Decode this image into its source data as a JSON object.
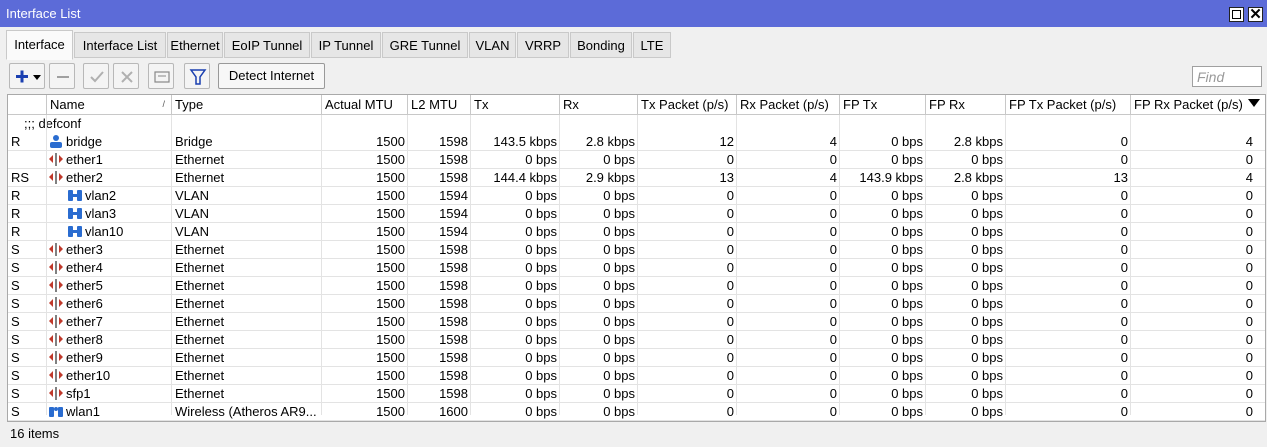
{
  "window": {
    "title": "Interface List"
  },
  "tabs": [
    {
      "label": "Interface"
    },
    {
      "label": "Interface List"
    },
    {
      "label": "Ethernet"
    },
    {
      "label": "EoIP Tunnel"
    },
    {
      "label": "IP Tunnel"
    },
    {
      "label": "GRE Tunnel"
    },
    {
      "label": "VLAN"
    },
    {
      "label": "VRRP"
    },
    {
      "label": "Bonding"
    },
    {
      "label": "LTE"
    }
  ],
  "toolbar": {
    "add_icon": "plus-icon",
    "remove_icon": "minus-icon",
    "enable_icon": "check-icon",
    "disable_icon": "x-icon",
    "comment_icon": "comment-icon",
    "filter_icon": "filter-icon",
    "detect_label": "Detect Internet",
    "find_placeholder": "Find"
  },
  "columns": [
    {
      "label": ""
    },
    {
      "label": "Name"
    },
    {
      "label": "Type"
    },
    {
      "label": "Actual MTU"
    },
    {
      "label": "L2 MTU"
    },
    {
      "label": "Tx"
    },
    {
      "label": "Rx"
    },
    {
      "label": "Tx Packet (p/s)"
    },
    {
      "label": "Rx Packet (p/s)"
    },
    {
      "label": "FP Tx"
    },
    {
      "label": "FP Rx"
    },
    {
      "label": "FP Tx Packet (p/s)"
    },
    {
      "label": "FP Rx Packet (p/s)"
    }
  ],
  "group": {
    "label": ";;; defconf"
  },
  "rows": [
    {
      "flag": "R",
      "name": "bridge",
      "icon": "bridge",
      "type": "Bridge",
      "mtu": "1500",
      "l2mtu": "1598",
      "tx": "143.5 kbps",
      "rx": "2.8 kbps",
      "txp": "12",
      "rxp": "4",
      "fptx": "0 bps",
      "fprx": "2.8 kbps",
      "fptxp": "0",
      "fprxp": "4"
    },
    {
      "flag": "",
      "name": "ether1",
      "icon": "ethernet",
      "type": "Ethernet",
      "mtu": "1500",
      "l2mtu": "1598",
      "tx": "0 bps",
      "rx": "0 bps",
      "txp": "0",
      "rxp": "0",
      "fptx": "0 bps",
      "fprx": "0 bps",
      "fptxp": "0",
      "fprxp": "0"
    },
    {
      "flag": "RS",
      "name": "ether2",
      "icon": "ethernet",
      "type": "Ethernet",
      "mtu": "1500",
      "l2mtu": "1598",
      "tx": "144.4 kbps",
      "rx": "2.9 kbps",
      "txp": "13",
      "rxp": "4",
      "fptx": "143.9 kbps",
      "fprx": "2.8 kbps",
      "fptxp": "13",
      "fprxp": "4"
    },
    {
      "flag": "R",
      "name": "vlan2",
      "icon": "vlan",
      "type": "VLAN",
      "mtu": "1500",
      "l2mtu": "1594",
      "tx": "0 bps",
      "rx": "0 bps",
      "txp": "0",
      "rxp": "0",
      "fptx": "0 bps",
      "fprx": "0 bps",
      "fptxp": "0",
      "fprxp": "0"
    },
    {
      "flag": "R",
      "name": "vlan3",
      "icon": "vlan",
      "type": "VLAN",
      "mtu": "1500",
      "l2mtu": "1594",
      "tx": "0 bps",
      "rx": "0 bps",
      "txp": "0",
      "rxp": "0",
      "fptx": "0 bps",
      "fprx": "0 bps",
      "fptxp": "0",
      "fprxp": "0"
    },
    {
      "flag": "R",
      "name": "vlan10",
      "icon": "vlan",
      "type": "VLAN",
      "mtu": "1500",
      "l2mtu": "1594",
      "tx": "0 bps",
      "rx": "0 bps",
      "txp": "0",
      "rxp": "0",
      "fptx": "0 bps",
      "fprx": "0 bps",
      "fptxp": "0",
      "fprxp": "0"
    },
    {
      "flag": "S",
      "name": "ether3",
      "icon": "ethernet",
      "type": "Ethernet",
      "mtu": "1500",
      "l2mtu": "1598",
      "tx": "0 bps",
      "rx": "0 bps",
      "txp": "0",
      "rxp": "0",
      "fptx": "0 bps",
      "fprx": "0 bps",
      "fptxp": "0",
      "fprxp": "0"
    },
    {
      "flag": "S",
      "name": "ether4",
      "icon": "ethernet",
      "type": "Ethernet",
      "mtu": "1500",
      "l2mtu": "1598",
      "tx": "0 bps",
      "rx": "0 bps",
      "txp": "0",
      "rxp": "0",
      "fptx": "0 bps",
      "fprx": "0 bps",
      "fptxp": "0",
      "fprxp": "0"
    },
    {
      "flag": "S",
      "name": "ether5",
      "icon": "ethernet",
      "type": "Ethernet",
      "mtu": "1500",
      "l2mtu": "1598",
      "tx": "0 bps",
      "rx": "0 bps",
      "txp": "0",
      "rxp": "0",
      "fptx": "0 bps",
      "fprx": "0 bps",
      "fptxp": "0",
      "fprxp": "0"
    },
    {
      "flag": "S",
      "name": "ether6",
      "icon": "ethernet",
      "type": "Ethernet",
      "mtu": "1500",
      "l2mtu": "1598",
      "tx": "0 bps",
      "rx": "0 bps",
      "txp": "0",
      "rxp": "0",
      "fptx": "0 bps",
      "fprx": "0 bps",
      "fptxp": "0",
      "fprxp": "0"
    },
    {
      "flag": "S",
      "name": "ether7",
      "icon": "ethernet",
      "type": "Ethernet",
      "mtu": "1500",
      "l2mtu": "1598",
      "tx": "0 bps",
      "rx": "0 bps",
      "txp": "0",
      "rxp": "0",
      "fptx": "0 bps",
      "fprx": "0 bps",
      "fptxp": "0",
      "fprxp": "0"
    },
    {
      "flag": "S",
      "name": "ether8",
      "icon": "ethernet",
      "type": "Ethernet",
      "mtu": "1500",
      "l2mtu": "1598",
      "tx": "0 bps",
      "rx": "0 bps",
      "txp": "0",
      "rxp": "0",
      "fptx": "0 bps",
      "fprx": "0 bps",
      "fptxp": "0",
      "fprxp": "0"
    },
    {
      "flag": "S",
      "name": "ether9",
      "icon": "ethernet",
      "type": "Ethernet",
      "mtu": "1500",
      "l2mtu": "1598",
      "tx": "0 bps",
      "rx": "0 bps",
      "txp": "0",
      "rxp": "0",
      "fptx": "0 bps",
      "fprx": "0 bps",
      "fptxp": "0",
      "fprxp": "0"
    },
    {
      "flag": "S",
      "name": "ether10",
      "icon": "ethernet",
      "type": "Ethernet",
      "mtu": "1500",
      "l2mtu": "1598",
      "tx": "0 bps",
      "rx": "0 bps",
      "txp": "0",
      "rxp": "0",
      "fptx": "0 bps",
      "fprx": "0 bps",
      "fptxp": "0",
      "fprxp": "0"
    },
    {
      "flag": "S",
      "name": "sfp1",
      "icon": "ethernet",
      "type": "Ethernet",
      "mtu": "1500",
      "l2mtu": "1598",
      "tx": "0 bps",
      "rx": "0 bps",
      "txp": "0",
      "rxp": "0",
      "fptx": "0 bps",
      "fprx": "0 bps",
      "fptxp": "0",
      "fprxp": "0"
    },
    {
      "flag": "S",
      "name": "wlan1",
      "icon": "wireless",
      "type": "Wireless (Atheros AR9...",
      "mtu": "1500",
      "l2mtu": "1600",
      "tx": "0 bps",
      "rx": "0 bps",
      "txp": "0",
      "rxp": "0",
      "fptx": "0 bps",
      "fprx": "0 bps",
      "fptxp": "0",
      "fprxp": "0"
    }
  ],
  "status": {
    "count": "16 items"
  },
  "colors": {
    "titlebar": "#5c6bd8",
    "accent_plus": "#1a3fb0",
    "vlan_icon": "#2a6cd0"
  }
}
